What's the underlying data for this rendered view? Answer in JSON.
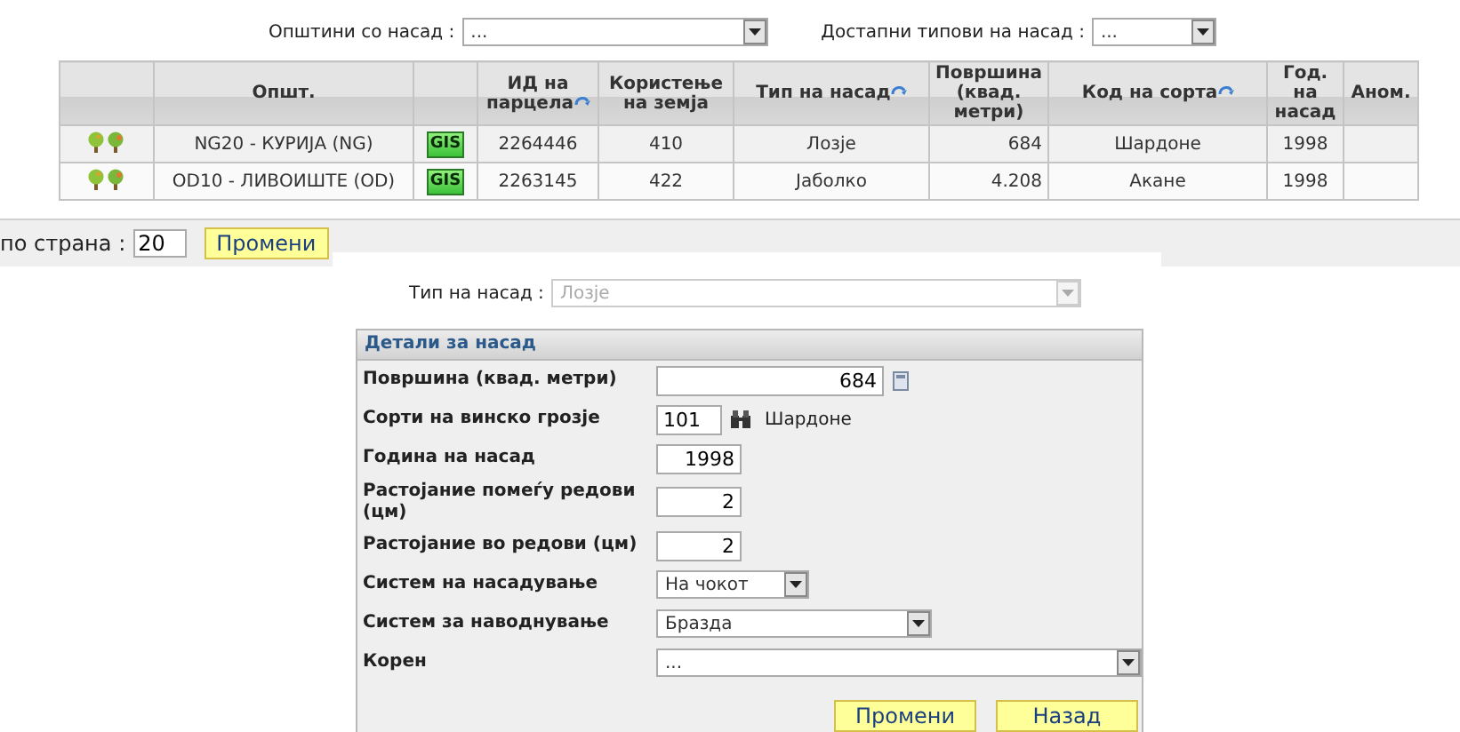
{
  "filters": [
    {
      "label": "Општини со насад :",
      "value": "..."
    },
    {
      "label": "Достапни типови на насад :",
      "value": "..."
    }
  ],
  "table": {
    "columns": [
      {
        "sortable": false
      },
      {
        "label": "Општ.",
        "sortable": false
      },
      {
        "sortable": false
      },
      {
        "label": "ИД на парцела",
        "sortable": true
      },
      {
        "label": "Користење на земја",
        "sortable": false
      },
      {
        "label": "Тип на насад",
        "sortable": true
      },
      {
        "label": "Површина (квад. метри)",
        "sortable": false
      },
      {
        "label": "Код на сорта",
        "sortable": true
      },
      {
        "label": "Год. на насад",
        "sortable": false
      },
      {
        "label": "Аном.",
        "sortable": false
      }
    ],
    "rows": [
      {
        "municipality": "NG20 - КУРИЈА (NG)",
        "gis": "GIS",
        "parcel_id": "2264446",
        "land_use": "410",
        "plant_type": "Лозје",
        "area": "684",
        "variety": "Шардоне",
        "year": "1998"
      },
      {
        "municipality": "OD10 - ЛИВОИШТЕ (OD)",
        "gis": "GIS",
        "parcel_id": "2263145",
        "land_use": "422",
        "plant_type": "Јаболко",
        "area": "4.208",
        "variety": "Акане",
        "year": "1998"
      }
    ]
  },
  "pager": {
    "label": "по страна :",
    "value": "20",
    "button": "Промени"
  },
  "plant_type": {
    "label": "Тип на насад :",
    "value": "Лозје",
    "disabled": true
  },
  "details": {
    "title": "Детали за насад",
    "fields": [
      {
        "kind": "measure",
        "label": "Површина (квад. метри)",
        "value": "684"
      },
      {
        "kind": "lookup",
        "label": "Сорти на винско грозје",
        "value": "101",
        "note": "Шардоне"
      },
      {
        "kind": "number",
        "label": "Година на насад",
        "value": "1998"
      },
      {
        "kind": "number",
        "label": "Растојание помеѓу редови (цм)",
        "value": "2"
      },
      {
        "kind": "number",
        "label": "Растојание во редови (цм)",
        "value": "2"
      },
      {
        "kind": "select",
        "label": "Систем на насадување",
        "value": "На чокот"
      },
      {
        "kind": "select",
        "label": "Систем за наводнување",
        "value": "Бразда"
      },
      {
        "kind": "select",
        "label": "Корен",
        "value": "..."
      }
    ],
    "buttons": [
      "Промени",
      "Назад"
    ]
  }
}
